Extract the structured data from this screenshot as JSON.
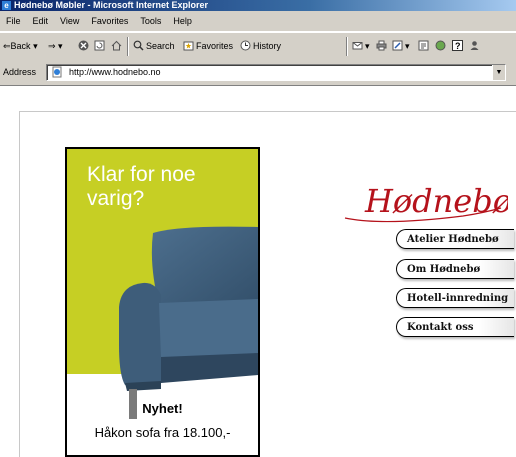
{
  "window": {
    "title": "Hødnebø Møbler - Microsoft Internet Explorer"
  },
  "menu": {
    "items": [
      "File",
      "Edit",
      "View",
      "Favorites",
      "Tools",
      "Help"
    ]
  },
  "toolbar": {
    "back_label": "Back",
    "search_label": "Search",
    "favorites_label": "Favorites",
    "history_label": "History"
  },
  "address": {
    "label": "Address",
    "url": "http://www.hodnebo.no"
  },
  "ad": {
    "headline": "Klar for noe varig?",
    "badge": "Nyhet!",
    "offer": "Håkon sofa fra 18.100,-"
  },
  "site": {
    "logo_text": "Hødnebø",
    "nav": [
      "Atelier Hødnebø",
      "Om Hødnebø",
      "Hotell-innredning",
      "Kontakt oss"
    ]
  },
  "colors": {
    "ad_green": "#c6cf24",
    "logo_red": "#b5121b",
    "sofa_blue": "#41607d"
  }
}
